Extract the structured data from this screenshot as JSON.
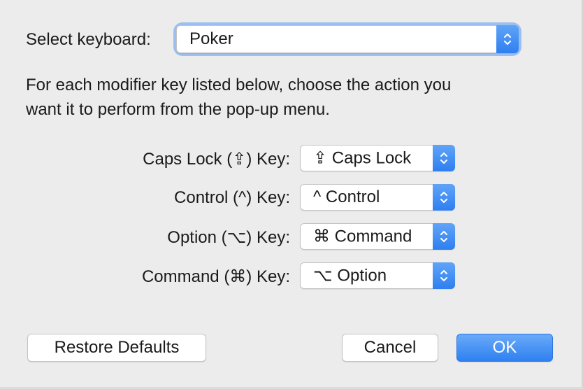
{
  "select_keyboard": {
    "label": "Select keyboard:",
    "value": "Poker"
  },
  "instructions": {
    "line1": "For each modifier key listed below, choose the action you",
    "line2": "want it to perform from the pop-up menu."
  },
  "modifiers": [
    {
      "label": "Caps Lock (⇪) Key:",
      "value": "⇪ Caps Lock"
    },
    {
      "label": "Control (^) Key:",
      "value": "^ Control"
    },
    {
      "label": "Option (⌥) Key:",
      "value": "⌘ Command"
    },
    {
      "label": "Command (⌘) Key:",
      "value": "⌥ Option"
    }
  ],
  "buttons": {
    "restore": "Restore Defaults",
    "cancel": "Cancel",
    "ok": "OK"
  },
  "colors": {
    "background": "#ececec",
    "accent": "#2f80f0",
    "text": "#1a1a1a"
  },
  "icons": {
    "stepper": "up-down-chevron-icon"
  }
}
